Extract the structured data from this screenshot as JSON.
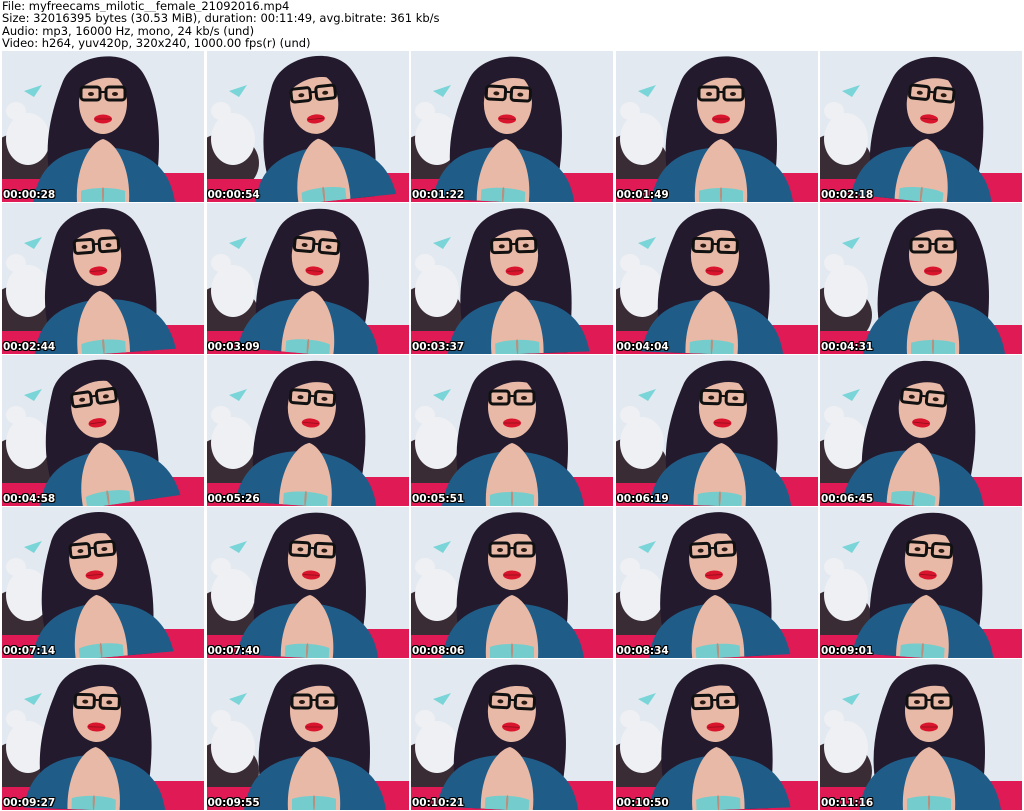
{
  "header": {
    "line1": "File: myfreecams_milotic__female_21092016.mp4",
    "line2": "Size: 32016395 bytes (30.53 MiB), duration: 00:11:49, avg.bitrate: 361 kb/s",
    "line3": "Audio: mp3, 16000 Hz, mono, 24 kb/s (und)",
    "line4": "Video: h264, yuv420p, 320x240, 1000.00 fps(r) (und)"
  },
  "frames": [
    {
      "time": "00:00:28"
    },
    {
      "time": "00:00:54"
    },
    {
      "time": "00:01:22"
    },
    {
      "time": "00:01:49"
    },
    {
      "time": "00:02:18"
    },
    {
      "time": "00:02:44"
    },
    {
      "time": "00:03:09"
    },
    {
      "time": "00:03:37"
    },
    {
      "time": "00:04:04"
    },
    {
      "time": "00:04:31"
    },
    {
      "time": "00:04:58"
    },
    {
      "time": "00:05:26"
    },
    {
      "time": "00:05:51"
    },
    {
      "time": "00:06:19"
    },
    {
      "time": "00:06:45"
    },
    {
      "time": "00:07:14"
    },
    {
      "time": "00:07:40"
    },
    {
      "time": "00:08:06"
    },
    {
      "time": "00:08:34"
    },
    {
      "time": "00:09:01"
    },
    {
      "time": "00:09:27"
    },
    {
      "time": "00:09:55"
    },
    {
      "time": "00:10:21"
    },
    {
      "time": "00:10:50"
    },
    {
      "time": "00:11:16"
    }
  ],
  "colors": {
    "background_wall": "#e3e9f0",
    "hair": "#231a2e",
    "skin": "#e8b9a6",
    "top": "#1f5d88",
    "top_shadow": "#174a6f",
    "lips": "#d9152e",
    "glasses": "#111111",
    "bedding": "#e01a55",
    "plush": "#eef0f4",
    "teal_trim": "#5fd0d2",
    "dark_cushion": "#3a2c35"
  }
}
